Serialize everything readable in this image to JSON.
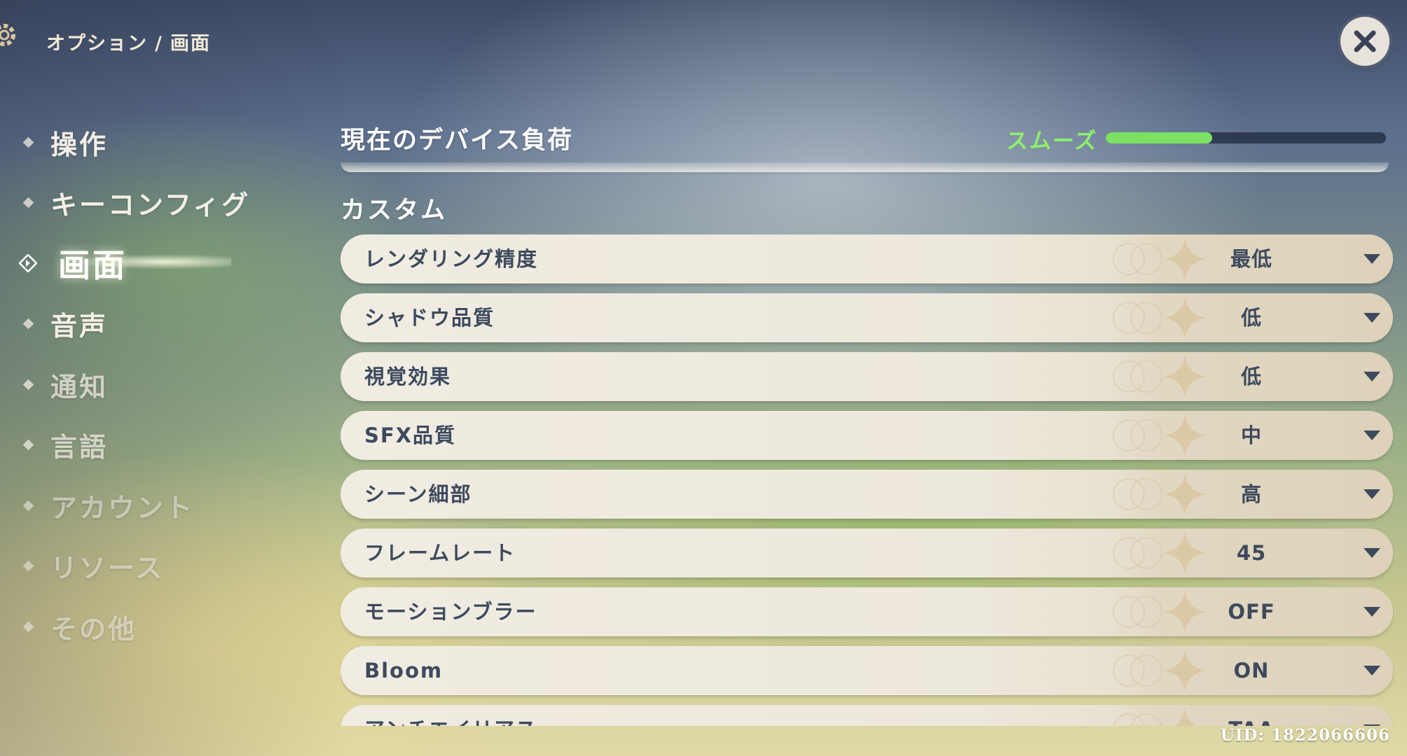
{
  "header": {
    "breadcrumb_parent": "オプション",
    "breadcrumb_separator": "/",
    "breadcrumb_current": "画面",
    "icons": {
      "settings": "gear-icon",
      "close": "close-icon"
    }
  },
  "sidebar": {
    "items": [
      {
        "label": "操作",
        "active": false
      },
      {
        "label": "キーコンフィグ",
        "active": false
      },
      {
        "label": "画面",
        "active": true
      },
      {
        "label": "音声",
        "active": false
      },
      {
        "label": "通知",
        "active": false
      },
      {
        "label": "言語",
        "active": false
      },
      {
        "label": "アカウント",
        "active": false
      },
      {
        "label": "リソース",
        "active": false
      },
      {
        "label": "その他",
        "active": false
      }
    ]
  },
  "device_load": {
    "title": "現在のデバイス負荷",
    "status": "スムーズ",
    "level": 0.38,
    "status_color": "#8df06b"
  },
  "custom": {
    "section_label": "カスタム",
    "settings": [
      {
        "name": "レンダリング精度",
        "value": "最低"
      },
      {
        "name": "シャドウ品質",
        "value": "低"
      },
      {
        "name": "視覚効果",
        "value": "低"
      },
      {
        "name": "SFX品質",
        "value": "中"
      },
      {
        "name": "シーン細部",
        "value": "高"
      },
      {
        "name": "フレームレート",
        "value": "45"
      },
      {
        "name": "モーションブラー",
        "value": "OFF"
      },
      {
        "name": "Bloom",
        "value": "ON"
      },
      {
        "name": "アンチエイリアス",
        "value": "TAA"
      }
    ]
  },
  "footer": {
    "uid": "UID: 1822066606"
  },
  "colors": {
    "text_dark": "#3d4a5e",
    "row_background": "#efeae0",
    "accent_green": "#7de064"
  }
}
